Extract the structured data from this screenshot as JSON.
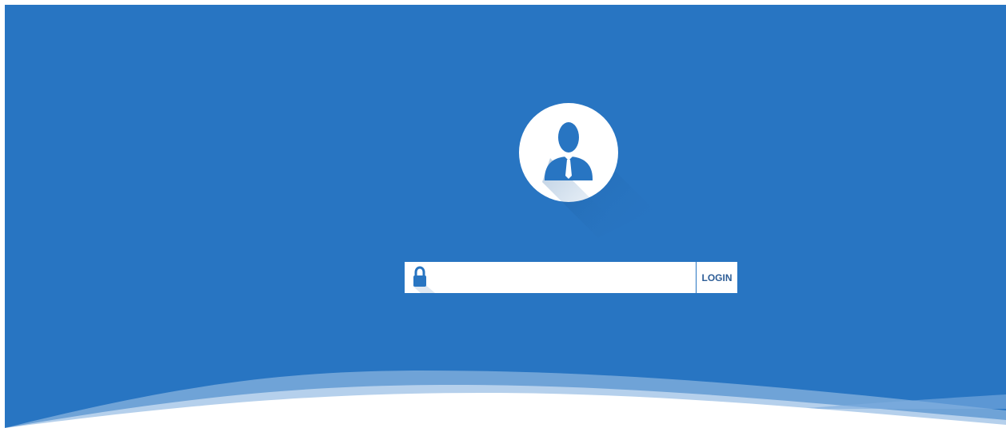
{
  "login": {
    "password_placeholder": "",
    "password_value": "",
    "button_label": "LOGIN"
  },
  "colors": {
    "background": "#2875c2",
    "accent_text": "#2d5d97",
    "white": "#ffffff"
  },
  "icons": {
    "avatar": "user-avatar-icon",
    "lock": "lock-icon"
  }
}
